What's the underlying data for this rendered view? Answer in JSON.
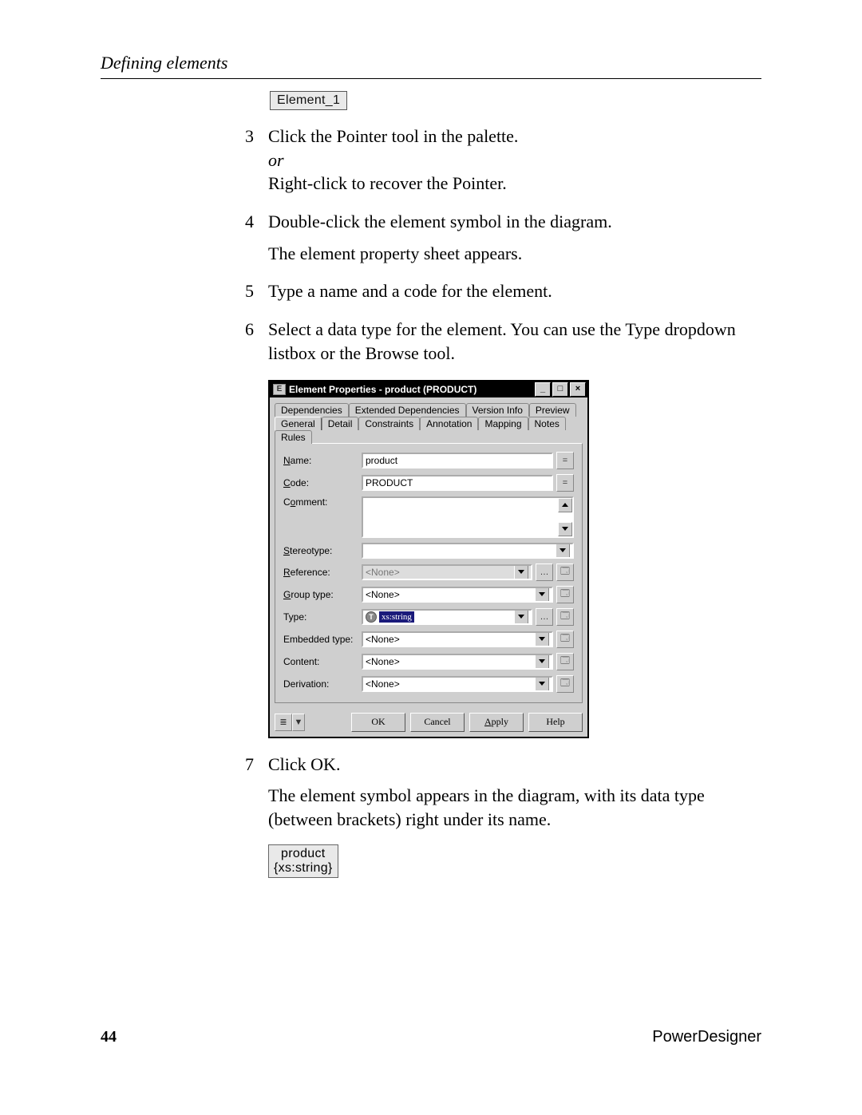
{
  "header": {
    "title": "Defining elements"
  },
  "badge_before": "Element_1",
  "steps": {
    "s3": {
      "num": "3",
      "line1": "Click the Pointer tool in the palette.",
      "or": "or",
      "line2": "Right-click to recover the Pointer."
    },
    "s4": {
      "num": "4",
      "line1": "Double-click the element symbol in the diagram.",
      "after": "The element property sheet appears."
    },
    "s5": {
      "num": "5",
      "line1": "Type a name and a code for the element."
    },
    "s6": {
      "num": "6",
      "line1": "Select a data type for the element. You can use the Type dropdown listbox or the Browse tool."
    },
    "s7": {
      "num": "7",
      "line1": "Click OK.",
      "after": "The element symbol appears in the diagram, with its data type (between brackets) right under its name."
    }
  },
  "dialog": {
    "title": "Element Properties - product (PRODUCT)",
    "winbtns": {
      "min": "_",
      "max": "□",
      "close": "×"
    },
    "tabs_row1": [
      "Dependencies",
      "Extended Dependencies",
      "Version Info",
      "Preview"
    ],
    "tabs_row2": [
      "General",
      "Detail",
      "Constraints",
      "Annotation",
      "Mapping",
      "Notes",
      "Rules"
    ],
    "active_tab": "General",
    "fields": {
      "name": {
        "label": "Name:",
        "value": "product",
        "eqbtn": "="
      },
      "code": {
        "label": "Code:",
        "value": "PRODUCT",
        "eqbtn": "="
      },
      "comment": {
        "label": "Comment:"
      },
      "stereotype": {
        "label": "Stereotype:",
        "value": ""
      },
      "reference": {
        "label": "Reference:",
        "value": "<None>",
        "disabled": true
      },
      "group_type": {
        "label": "Group type:",
        "value": "<None>"
      },
      "type": {
        "label": "Type:",
        "value": "xs:string"
      },
      "embedded": {
        "label": "Embedded type:",
        "value": "<None>"
      },
      "content": {
        "label": "Content:",
        "value": "<None>"
      },
      "derivation": {
        "label": "Derivation:",
        "value": "<None>"
      }
    },
    "buttons": {
      "ok": "OK",
      "cancel": "Cancel",
      "apply": "Apply",
      "help": "Help"
    },
    "menu_arrow": "▼"
  },
  "badge_after": {
    "line1": "product",
    "line2": "{xs:string}"
  },
  "footer": {
    "page": "44",
    "brand": "PowerDesigner"
  }
}
